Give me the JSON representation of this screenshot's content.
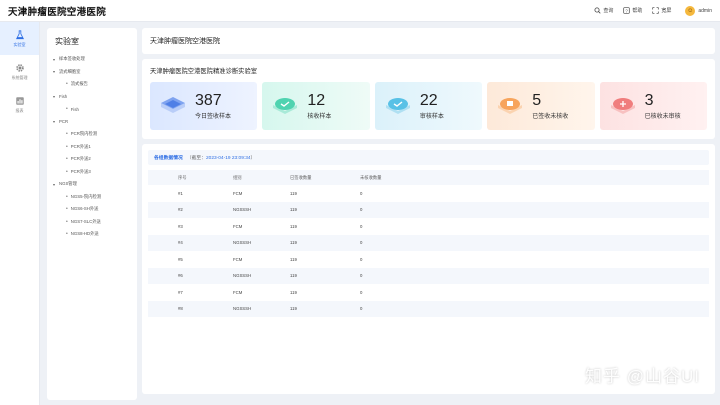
{
  "app": {
    "title": "天津肿瘤医院空港医院"
  },
  "top_actions": [
    {
      "label": "查询",
      "icon": "search-icon"
    },
    {
      "label": "帮助",
      "icon": "help-icon"
    },
    {
      "label": "宽屏",
      "icon": "fullscreen-icon"
    }
  ],
  "user": {
    "name": "admin"
  },
  "rail": [
    {
      "label": "实验室",
      "icon": "flask-icon"
    },
    {
      "label": "系统管理",
      "icon": "gear-icon"
    },
    {
      "label": "报表",
      "icon": "report-icon"
    }
  ],
  "sidenav": {
    "title": "实验室",
    "items": [
      {
        "label": "样本签收处理",
        "level": 0
      },
      {
        "label": "流式细胞室",
        "level": 0
      },
      {
        "label": "流式报告",
        "level": 1
      },
      {
        "label": "Fish",
        "level": 0
      },
      {
        "label": "Fish",
        "level": 1
      },
      {
        "label": "PCR",
        "level": 0
      },
      {
        "label": "PCR院内检测",
        "level": 1
      },
      {
        "label": "PCR外送1",
        "level": 1
      },
      {
        "label": "PCR外送2",
        "level": 1
      },
      {
        "label": "PCR外送3",
        "level": 1
      },
      {
        "label": "NGS管理",
        "level": 0
      },
      {
        "label": "NGS5-院内检测",
        "level": 1
      },
      {
        "label": "NGS6-SH外送",
        "level": 1
      },
      {
        "label": "NGS7-SLC外送",
        "level": 1
      },
      {
        "label": "NGS8-HD外送",
        "level": 1
      }
    ]
  },
  "main": {
    "page_title": "天津肿瘤医院空港医院",
    "lab_title": "天津肿瘤医院空港医院精准诊断实验室",
    "cards": [
      {
        "value": "387",
        "label": "今日签收样本"
      },
      {
        "value": "12",
        "label": "核收样本"
      },
      {
        "value": "22",
        "label": "审核样本"
      },
      {
        "value": "5",
        "label": "已签收未核收"
      },
      {
        "value": "3",
        "label": "已核收未审核"
      }
    ],
    "table_title": "各组数据情况",
    "table_note_prefix": "（截至：",
    "table_note_time": "2023-04-19  23:09:34",
    "table_note_suffix": "）",
    "columns": [
      "序号",
      "组别",
      "已签收数量",
      "未核收数量"
    ],
    "rows": [
      [
        "#1",
        "FCM",
        "119",
        "0"
      ],
      [
        "#2",
        "NGSSSH",
        "119",
        "0"
      ],
      [
        "#3",
        "FCM",
        "119",
        "0"
      ],
      [
        "#4",
        "NGSSSH",
        "119",
        "0"
      ],
      [
        "#5",
        "FCM",
        "119",
        "0"
      ],
      [
        "#6",
        "NGSSSH",
        "119",
        "0"
      ],
      [
        "#7",
        "FCM",
        "119",
        "0"
      ],
      [
        "#8",
        "NGSSSH",
        "119",
        "0"
      ]
    ]
  },
  "watermark": "知乎 @山谷UI"
}
